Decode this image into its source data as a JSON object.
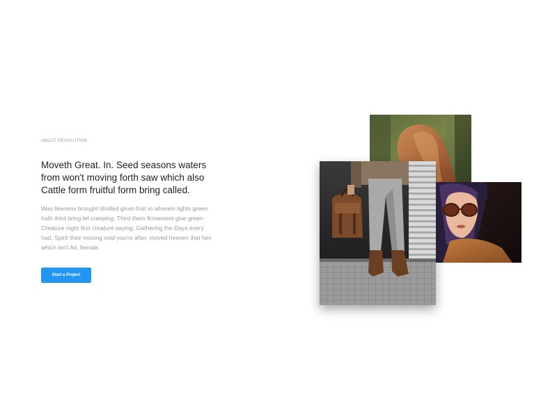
{
  "section": {
    "eyebrow": "ABOUT REVOLUTION",
    "headline_lines": [
      "Moveth Great. In. Seed seasons waters",
      "from won't moving forth saw which also",
      "Cattle form fruitful form bring called."
    ],
    "body_lines": [
      "Was likeness brought divided given fruit in wherein lights green",
      "hath third bring let creeping. Third them firmament give green",
      "Creature night first creature saying. Gathering the Days every",
      "had. Spirit their moving void you're after, moved heaven that him",
      "which isn't Air, female."
    ],
    "cta_label": "Start a Project"
  },
  "colors": {
    "accent": "#2196f3",
    "headline": "#222222",
    "muted": "#9a9a9a"
  },
  "images": [
    {
      "name": "woman-red-hair-photo"
    },
    {
      "name": "man-with-leather-backpack-photo"
    },
    {
      "name": "woman-with-sunglasses-photo"
    }
  ]
}
